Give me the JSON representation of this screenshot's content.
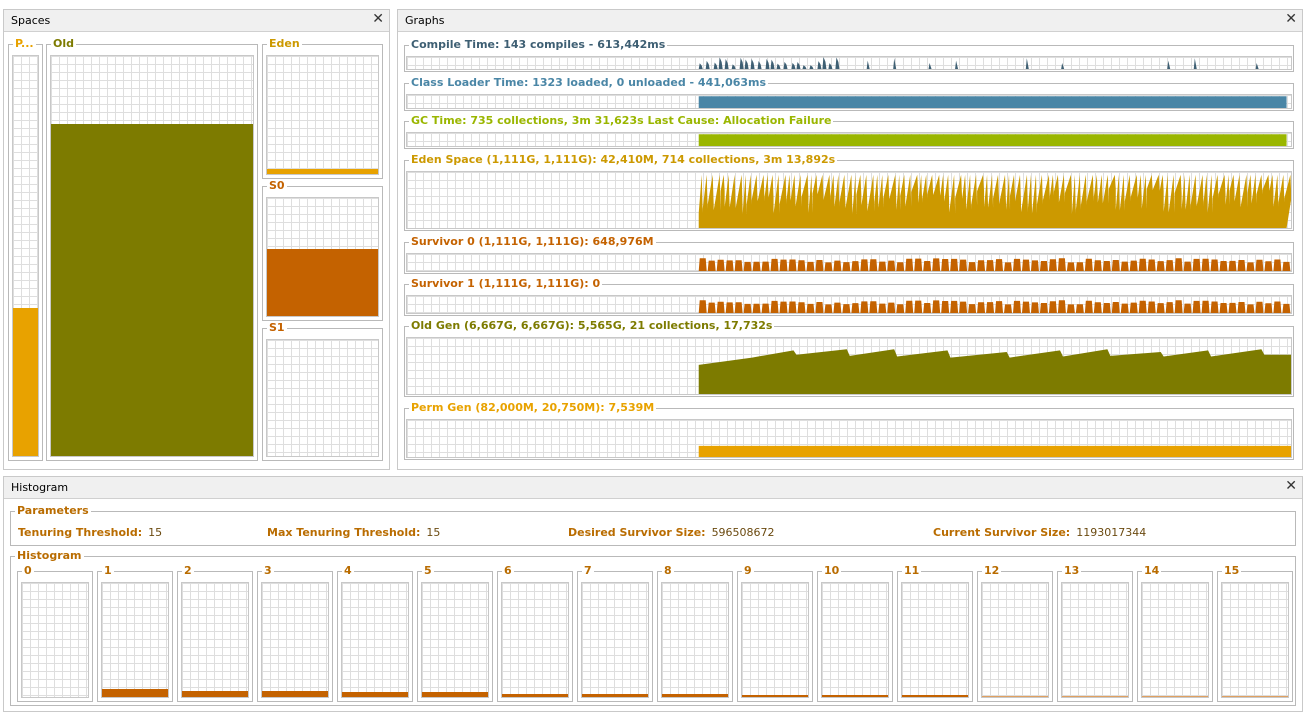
{
  "colors": {
    "compile": "#3e5f73",
    "classloader": "#4a86a6",
    "gc": "#9ab600",
    "eden": "#cc9900",
    "survivor": "#c46200",
    "old": "#7d7b00",
    "perm": "#e8a200",
    "label_brown": "#b96c00"
  },
  "spaces": {
    "title": "Spaces",
    "perm_label": "P...",
    "old_label": "Old",
    "eden_label": "Eden",
    "s0_label": "S0",
    "s1_label": "S1",
    "perm_fill_fraction": 0.37,
    "old_fill_fraction": 0.83,
    "eden_fill_fraction": 0.04,
    "s0_fill_fraction": 0.57,
    "s1_fill_fraction": 0.0
  },
  "graphs": {
    "title": "Graphs",
    "rows": [
      {
        "key": "compile",
        "label": "Compile Time: 143 compiles - 613,442ms",
        "color": "#3e5f73",
        "kind": "spikes"
      },
      {
        "key": "classloader",
        "label": "Class Loader Time: 1323 loaded, 0 unloaded - 441,063ms",
        "color": "#4a86a6",
        "kind": "block"
      },
      {
        "key": "gc",
        "label": "GC Time: 735 collections, 3m 31,623s  Last Cause: Allocation Failure",
        "color": "#9ab600",
        "kind": "block"
      },
      {
        "key": "eden",
        "label": "Eden Space (1,111G, 1,111G): 42,410M, 714 collections, 3m 13,892s",
        "color": "#cc9900",
        "kind": "saw"
      },
      {
        "key": "s0",
        "label": "Survivor 0 (1,111G, 1,111G): 648,976M",
        "color": "#c46200",
        "kind": "bumps"
      },
      {
        "key": "s1",
        "label": "Survivor 1 (1,111G, 1,111G): 0",
        "color": "#c46200",
        "kind": "bumps"
      },
      {
        "key": "old",
        "label": "Old Gen (6,667G, 6,667G): 5,565G, 21 collections, 17,732s",
        "color": "#7d7b00",
        "kind": "old"
      },
      {
        "key": "perm",
        "label": "Perm Gen (82,000M, 20,750M): 7,539M",
        "color": "#e8a200",
        "kind": "flat"
      }
    ]
  },
  "histogram": {
    "title": "Histogram",
    "parameters_label": "Parameters",
    "params": [
      {
        "label": "Tenuring Threshold:",
        "value": "15"
      },
      {
        "label": "Max Tenuring Threshold:",
        "value": "15"
      },
      {
        "label": "Desired Survivor Size:",
        "value": "596508672"
      },
      {
        "label": "Current Survivor Size:",
        "value": "1193017344"
      }
    ],
    "histogram_label": "Histogram",
    "bins": [
      {
        "label": "0",
        "fraction": 0.0
      },
      {
        "label": "1",
        "fraction": 0.07
      },
      {
        "label": "2",
        "fraction": 0.05
      },
      {
        "label": "3",
        "fraction": 0.05
      },
      {
        "label": "4",
        "fraction": 0.04
      },
      {
        "label": "5",
        "fraction": 0.04
      },
      {
        "label": "6",
        "fraction": 0.03
      },
      {
        "label": "7",
        "fraction": 0.03
      },
      {
        "label": "8",
        "fraction": 0.03
      },
      {
        "label": "9",
        "fraction": 0.02
      },
      {
        "label": "10",
        "fraction": 0.02
      },
      {
        "label": "11",
        "fraction": 0.02
      },
      {
        "label": "12",
        "fraction": 0.01
      },
      {
        "label": "13",
        "fraction": 0.01
      },
      {
        "label": "14",
        "fraction": 0.01
      },
      {
        "label": "15",
        "fraction": 0.01
      }
    ]
  }
}
